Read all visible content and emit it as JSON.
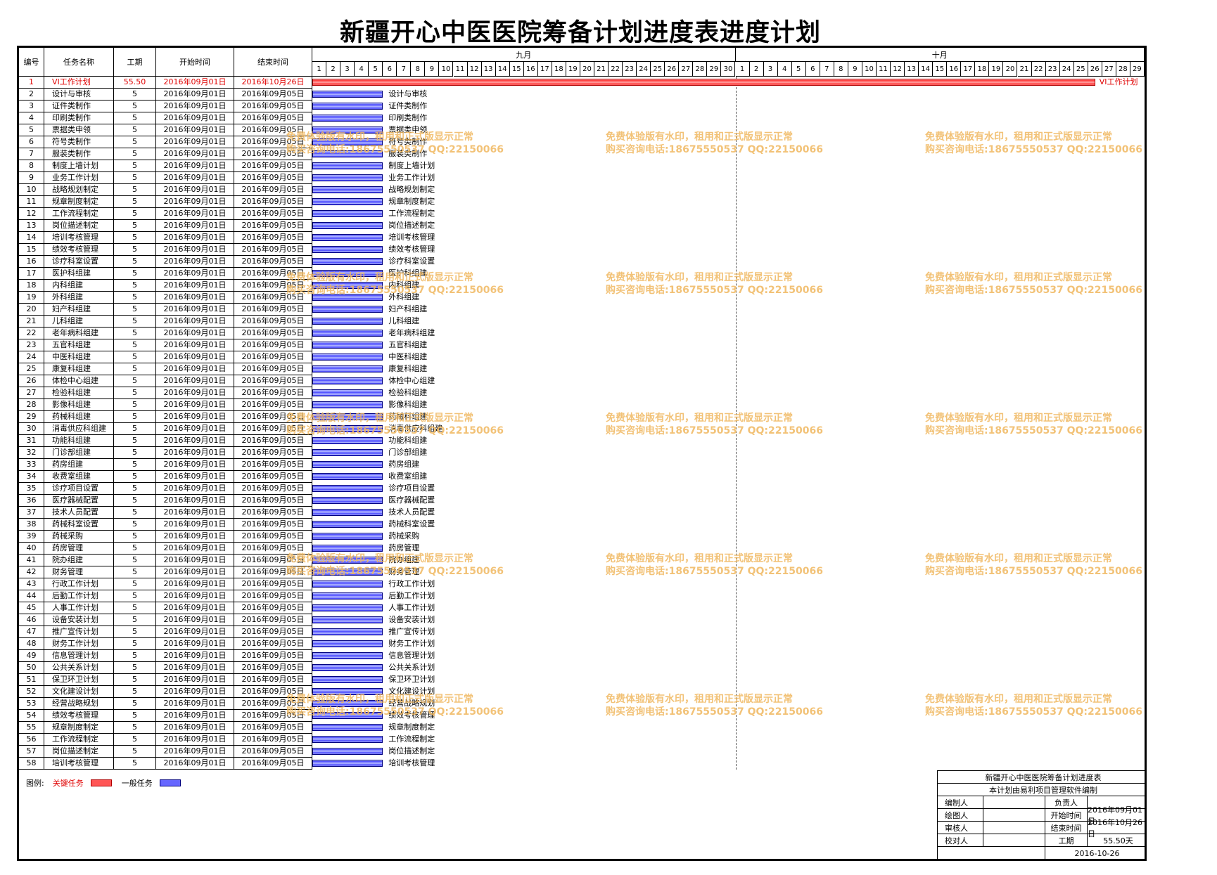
{
  "title": "新疆开心中医医院筹备计划进度表进度计划",
  "headers": {
    "id": "编号",
    "name": "任务名称",
    "duration": "工期",
    "start": "开始时间",
    "end": "结束时间"
  },
  "months": [
    {
      "label": "九月",
      "days": 30
    },
    {
      "label": "十月",
      "days": 29
    }
  ],
  "tasks": [
    {
      "id": "1",
      "name": "VI工作计划",
      "duration": "55.50",
      "start": "2016年09月01日",
      "end": "2016年10月26日",
      "critical": true,
      "start_day": 1,
      "span_days": 55.5
    },
    {
      "id": "2",
      "name": "设计与审核",
      "duration": "5",
      "start": "2016年09月01日",
      "end": "2016年09月05日",
      "critical": false,
      "start_day": 1,
      "span_days": 5
    },
    {
      "id": "3",
      "name": "证件类制作",
      "duration": "5",
      "start": "2016年09月01日",
      "end": "2016年09月05日",
      "critical": false,
      "start_day": 1,
      "span_days": 5
    },
    {
      "id": "4",
      "name": "印刷类制作",
      "duration": "5",
      "start": "2016年09月01日",
      "end": "2016年09月05日",
      "critical": false,
      "start_day": 1,
      "span_days": 5
    },
    {
      "id": "5",
      "name": "票据类申领",
      "duration": "5",
      "start": "2016年09月01日",
      "end": "2016年09月05日",
      "critical": false,
      "start_day": 1,
      "span_days": 5
    },
    {
      "id": "6",
      "name": "符号类制作",
      "duration": "5",
      "start": "2016年09月01日",
      "end": "2016年09月05日",
      "critical": false,
      "start_day": 1,
      "span_days": 5
    },
    {
      "id": "7",
      "name": "服装类制作",
      "duration": "5",
      "start": "2016年09月01日",
      "end": "2016年09月05日",
      "critical": false,
      "start_day": 1,
      "span_days": 5
    },
    {
      "id": "8",
      "name": "制度上墙计划",
      "duration": "5",
      "start": "2016年09月01日",
      "end": "2016年09月05日",
      "critical": false,
      "start_day": 1,
      "span_days": 5
    },
    {
      "id": "9",
      "name": "业务工作计划",
      "duration": "5",
      "start": "2016年09月01日",
      "end": "2016年09月05日",
      "critical": false,
      "start_day": 1,
      "span_days": 5
    },
    {
      "id": "10",
      "name": "战略规划制定",
      "duration": "5",
      "start": "2016年09月01日",
      "end": "2016年09月05日",
      "critical": false,
      "start_day": 1,
      "span_days": 5
    },
    {
      "id": "11",
      "name": "规章制度制定",
      "duration": "5",
      "start": "2016年09月01日",
      "end": "2016年09月05日",
      "critical": false,
      "start_day": 1,
      "span_days": 5
    },
    {
      "id": "12",
      "name": "工作流程制定",
      "duration": "5",
      "start": "2016年09月01日",
      "end": "2016年09月05日",
      "critical": false,
      "start_day": 1,
      "span_days": 5
    },
    {
      "id": "13",
      "name": "岗位描述制定",
      "duration": "5",
      "start": "2016年09月01日",
      "end": "2016年09月05日",
      "critical": false,
      "start_day": 1,
      "span_days": 5
    },
    {
      "id": "14",
      "name": "培训考核管理",
      "duration": "5",
      "start": "2016年09月01日",
      "end": "2016年09月05日",
      "critical": false,
      "start_day": 1,
      "span_days": 5
    },
    {
      "id": "15",
      "name": "绩效考核管理",
      "duration": "5",
      "start": "2016年09月01日",
      "end": "2016年09月05日",
      "critical": false,
      "start_day": 1,
      "span_days": 5
    },
    {
      "id": "16",
      "name": "诊疗科室设置",
      "duration": "5",
      "start": "2016年09月01日",
      "end": "2016年09月05日",
      "critical": false,
      "start_day": 1,
      "span_days": 5
    },
    {
      "id": "17",
      "name": "医护科组建",
      "duration": "5",
      "start": "2016年09月01日",
      "end": "2016年09月05日",
      "critical": false,
      "start_day": 1,
      "span_days": 5
    },
    {
      "id": "18",
      "name": "内科组建",
      "duration": "5",
      "start": "2016年09月01日",
      "end": "2016年09月05日",
      "critical": false,
      "start_day": 1,
      "span_days": 5
    },
    {
      "id": "19",
      "name": "外科组建",
      "duration": "5",
      "start": "2016年09月01日",
      "end": "2016年09月05日",
      "critical": false,
      "start_day": 1,
      "span_days": 5
    },
    {
      "id": "20",
      "name": "妇产科组建",
      "duration": "5",
      "start": "2016年09月01日",
      "end": "2016年09月05日",
      "critical": false,
      "start_day": 1,
      "span_days": 5
    },
    {
      "id": "21",
      "name": "儿科组建",
      "duration": "5",
      "start": "2016年09月01日",
      "end": "2016年09月05日",
      "critical": false,
      "start_day": 1,
      "span_days": 5
    },
    {
      "id": "22",
      "name": "老年病科组建",
      "duration": "5",
      "start": "2016年09月01日",
      "end": "2016年09月05日",
      "critical": false,
      "start_day": 1,
      "span_days": 5
    },
    {
      "id": "23",
      "name": "五官科组建",
      "duration": "5",
      "start": "2016年09月01日",
      "end": "2016年09月05日",
      "critical": false,
      "start_day": 1,
      "span_days": 5
    },
    {
      "id": "24",
      "name": "中医科组建",
      "duration": "5",
      "start": "2016年09月01日",
      "end": "2016年09月05日",
      "critical": false,
      "start_day": 1,
      "span_days": 5
    },
    {
      "id": "25",
      "name": "康复科组建",
      "duration": "5",
      "start": "2016年09月01日",
      "end": "2016年09月05日",
      "critical": false,
      "start_day": 1,
      "span_days": 5
    },
    {
      "id": "26",
      "name": "体检中心组建",
      "duration": "5",
      "start": "2016年09月01日",
      "end": "2016年09月05日",
      "critical": false,
      "start_day": 1,
      "span_days": 5
    },
    {
      "id": "27",
      "name": "检验科组建",
      "duration": "5",
      "start": "2016年09月01日",
      "end": "2016年09月05日",
      "critical": false,
      "start_day": 1,
      "span_days": 5
    },
    {
      "id": "28",
      "name": "影像科组建",
      "duration": "5",
      "start": "2016年09月01日",
      "end": "2016年09月05日",
      "critical": false,
      "start_day": 1,
      "span_days": 5
    },
    {
      "id": "29",
      "name": "药械科组建",
      "duration": "5",
      "start": "2016年09月01日",
      "end": "2016年09月05日",
      "critical": false,
      "start_day": 1,
      "span_days": 5
    },
    {
      "id": "30",
      "name": "消毒供应科组建",
      "duration": "5",
      "start": "2016年09月01日",
      "end": "2016年09月05日",
      "critical": false,
      "start_day": 1,
      "span_days": 5
    },
    {
      "id": "31",
      "name": "功能科组建",
      "duration": "5",
      "start": "2016年09月01日",
      "end": "2016年09月05日",
      "critical": false,
      "start_day": 1,
      "span_days": 5
    },
    {
      "id": "32",
      "name": "门诊部组建",
      "duration": "5",
      "start": "2016年09月01日",
      "end": "2016年09月05日",
      "critical": false,
      "start_day": 1,
      "span_days": 5
    },
    {
      "id": "33",
      "name": "药房组建",
      "duration": "5",
      "start": "2016年09月01日",
      "end": "2016年09月05日",
      "critical": false,
      "start_day": 1,
      "span_days": 5
    },
    {
      "id": "34",
      "name": "收费室组建",
      "duration": "5",
      "start": "2016年09月01日",
      "end": "2016年09月05日",
      "critical": false,
      "start_day": 1,
      "span_days": 5
    },
    {
      "id": "35",
      "name": "诊疗项目设置",
      "duration": "5",
      "start": "2016年09月01日",
      "end": "2016年09月05日",
      "critical": false,
      "start_day": 1,
      "span_days": 5
    },
    {
      "id": "36",
      "name": "医疗器械配置",
      "duration": "5",
      "start": "2016年09月01日",
      "end": "2016年09月05日",
      "critical": false,
      "start_day": 1,
      "span_days": 5
    },
    {
      "id": "37",
      "name": "技术人员配置",
      "duration": "5",
      "start": "2016年09月01日",
      "end": "2016年09月05日",
      "critical": false,
      "start_day": 1,
      "span_days": 5
    },
    {
      "id": "38",
      "name": "药械科室设置",
      "duration": "5",
      "start": "2016年09月01日",
      "end": "2016年09月05日",
      "critical": false,
      "start_day": 1,
      "span_days": 5
    },
    {
      "id": "39",
      "name": "药械采购",
      "duration": "5",
      "start": "2016年09月01日",
      "end": "2016年09月05日",
      "critical": false,
      "start_day": 1,
      "span_days": 5
    },
    {
      "id": "40",
      "name": "药房管理",
      "duration": "5",
      "start": "2016年09月01日",
      "end": "2016年09月05日",
      "critical": false,
      "start_day": 1,
      "span_days": 5
    },
    {
      "id": "41",
      "name": "院办组建",
      "duration": "5",
      "start": "2016年09月01日",
      "end": "2016年09月05日",
      "critical": false,
      "start_day": 1,
      "span_days": 5
    },
    {
      "id": "42",
      "name": "财务管理",
      "duration": "5",
      "start": "2016年09月01日",
      "end": "2016年09月05日",
      "critical": false,
      "start_day": 1,
      "span_days": 5
    },
    {
      "id": "43",
      "name": "行政工作计划",
      "duration": "5",
      "start": "2016年09月01日",
      "end": "2016年09月05日",
      "critical": false,
      "start_day": 1,
      "span_days": 5
    },
    {
      "id": "44",
      "name": "后勤工作计划",
      "duration": "5",
      "start": "2016年09月01日",
      "end": "2016年09月05日",
      "critical": false,
      "start_day": 1,
      "span_days": 5
    },
    {
      "id": "45",
      "name": "人事工作计划",
      "duration": "5",
      "start": "2016年09月01日",
      "end": "2016年09月05日",
      "critical": false,
      "start_day": 1,
      "span_days": 5
    },
    {
      "id": "46",
      "name": "设备安装计划",
      "duration": "5",
      "start": "2016年09月01日",
      "end": "2016年09月05日",
      "critical": false,
      "start_day": 1,
      "span_days": 5
    },
    {
      "id": "47",
      "name": "推广宣传计划",
      "duration": "5",
      "start": "2016年09月01日",
      "end": "2016年09月05日",
      "critical": false,
      "start_day": 1,
      "span_days": 5
    },
    {
      "id": "48",
      "name": "财务工作计划",
      "duration": "5",
      "start": "2016年09月01日",
      "end": "2016年09月05日",
      "critical": false,
      "start_day": 1,
      "span_days": 5
    },
    {
      "id": "49",
      "name": "信息管理计划",
      "duration": "5",
      "start": "2016年09月01日",
      "end": "2016年09月05日",
      "critical": false,
      "start_day": 1,
      "span_days": 5
    },
    {
      "id": "50",
      "name": "公共关系计划",
      "duration": "5",
      "start": "2016年09月01日",
      "end": "2016年09月05日",
      "critical": false,
      "start_day": 1,
      "span_days": 5
    },
    {
      "id": "51",
      "name": "保卫环卫计划",
      "duration": "5",
      "start": "2016年09月01日",
      "end": "2016年09月05日",
      "critical": false,
      "start_day": 1,
      "span_days": 5
    },
    {
      "id": "52",
      "name": "文化建设计划",
      "duration": "5",
      "start": "2016年09月01日",
      "end": "2016年09月05日",
      "critical": false,
      "start_day": 1,
      "span_days": 5
    },
    {
      "id": "53",
      "name": "经营战略规划",
      "duration": "5",
      "start": "2016年09月01日",
      "end": "2016年09月05日",
      "critical": false,
      "start_day": 1,
      "span_days": 5
    },
    {
      "id": "54",
      "name": "绩效考核管理",
      "duration": "5",
      "start": "2016年09月01日",
      "end": "2016年09月05日",
      "critical": false,
      "start_day": 1,
      "span_days": 5
    },
    {
      "id": "55",
      "name": "规章制度制定",
      "duration": "5",
      "start": "2016年09月01日",
      "end": "2016年09月05日",
      "critical": false,
      "start_day": 1,
      "span_days": 5
    },
    {
      "id": "56",
      "name": "工作流程制定",
      "duration": "5",
      "start": "2016年09月01日",
      "end": "2016年09月05日",
      "critical": false,
      "start_day": 1,
      "span_days": 5
    },
    {
      "id": "57",
      "name": "岗位描述制定",
      "duration": "5",
      "start": "2016年09月01日",
      "end": "2016年09月05日",
      "critical": false,
      "start_day": 1,
      "span_days": 5
    },
    {
      "id": "58",
      "name": "培训考核管理",
      "duration": "5",
      "start": "2016年09月01日",
      "end": "2016年09月05日",
      "critical": false,
      "start_day": 1,
      "span_days": 5
    }
  ],
  "legend": {
    "label": "图例:",
    "critical": "关键任务",
    "normal": "一般任务",
    "critical_color": "#ff5555",
    "normal_color": "#6666ff"
  },
  "watermark": {
    "line1": "免费体验版有水印，租用和正式版显示正常",
    "line2": "购买咨询电话:18675550537 QQ:22150066"
  },
  "info": {
    "title": "新疆开心中医医院筹备计划进度表",
    "subtitle": "本计划由易利项目管理软件编制",
    "editor_label": "编制人",
    "owner_label": "负责人",
    "drawer_label": "绘图人",
    "start_label": "开始时间",
    "start_value": "2016年09月01日",
    "reviewer_label": "审核人",
    "end_label": "结束时间",
    "end_value": "2016年10月26日",
    "proofreader_label": "校对人",
    "duration_label": "工期",
    "duration_value": "55.50天",
    "date": "2016-10-26"
  }
}
